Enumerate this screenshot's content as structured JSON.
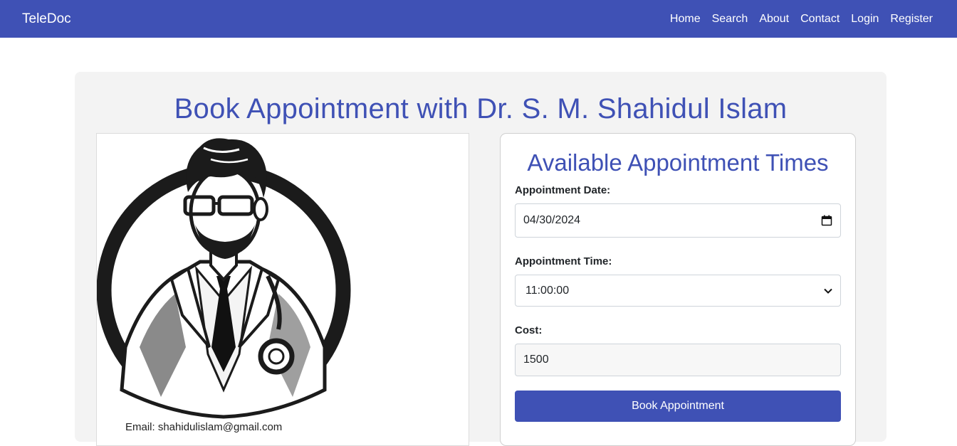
{
  "nav": {
    "brand": "TeleDoc",
    "links": [
      "Home",
      "Search",
      "About",
      "Contact",
      "Login",
      "Register"
    ]
  },
  "page": {
    "title": "Book Appointment with Dr. S. M. Shahidul Islam"
  },
  "doctor": {
    "email_text": "Email: shahidulislam@gmail.com"
  },
  "booking": {
    "title": "Available Appointment Times",
    "date_label": "Appointment Date:",
    "date_value": "04/30/2024",
    "time_label": "Appointment Time:",
    "time_value": "11:00:00",
    "cost_label": "Cost:",
    "cost_value": "1500",
    "button_label": "Book Appointment"
  },
  "colors": {
    "brand": "#3f51b5",
    "card_bg": "#f3f3f3"
  }
}
